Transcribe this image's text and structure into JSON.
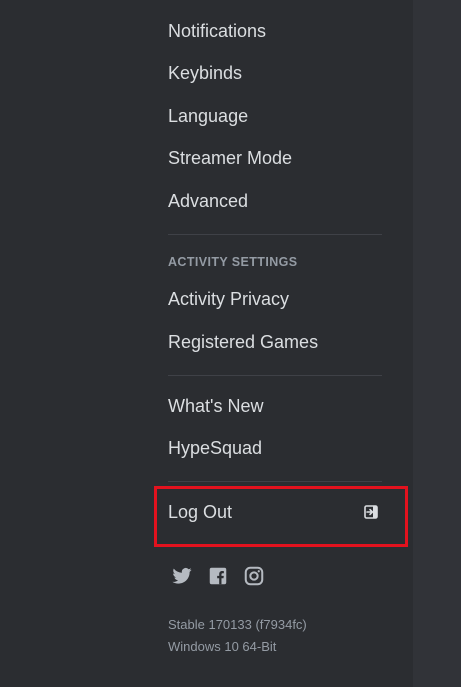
{
  "nav": {
    "app_settings_items": [
      {
        "label": "Notifications"
      },
      {
        "label": "Keybinds"
      },
      {
        "label": "Language"
      },
      {
        "label": "Streamer Mode"
      },
      {
        "label": "Advanced"
      }
    ],
    "activity_header": "ACTIVITY SETTINGS",
    "activity_items": [
      {
        "label": "Activity Privacy"
      },
      {
        "label": "Registered Games"
      }
    ],
    "misc_items": [
      {
        "label": "What's New"
      },
      {
        "label": "HypeSquad"
      }
    ],
    "logout": {
      "label": "Log Out",
      "icon": "logout-icon"
    }
  },
  "social": [
    {
      "icon": "twitter-icon"
    },
    {
      "icon": "facebook-icon"
    },
    {
      "icon": "instagram-icon"
    }
  ],
  "version": {
    "build": "Stable 170133 (f7934fc)",
    "os": "Windows 10 64-Bit"
  },
  "colors": {
    "sidebar_bg": "#2b2d31",
    "content_bg": "#313338",
    "text": "#dbdee1",
    "muted": "#949ba4",
    "highlight": "#e3121e"
  }
}
